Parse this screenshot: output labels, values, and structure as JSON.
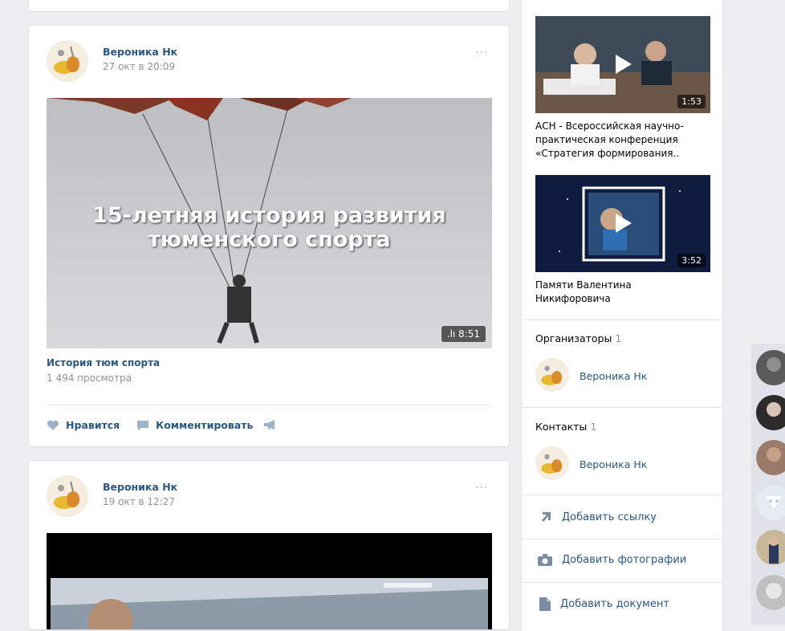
{
  "posts": [
    {
      "author": "Вероника Нк",
      "date": "27 окт в 20:09",
      "more": "···",
      "video": {
        "overlay_line1": "15-летняя история развития",
        "overlay_line2": "тюменского спорта",
        "duration": "8:51",
        "title": "История тюм спорта",
        "views": "1 494 просмотра"
      },
      "actions": {
        "like": "Нравится",
        "comment": "Комментировать"
      }
    },
    {
      "author": "Вероника Нк",
      "date": "19 окт в 12:27",
      "more": "···"
    }
  ],
  "sidebar": {
    "videos": [
      {
        "duration": "1:53",
        "title": "АСН - Всероссийская научно-практическая конференция «Стратегия формирования.."
      },
      {
        "duration": "3:52",
        "title": "Памяти Валентина Никифоровича"
      }
    ],
    "organizers": {
      "label": "Организаторы",
      "count": "1",
      "name": "Вероника Нк"
    },
    "contacts": {
      "label": "Контакты",
      "count": "1",
      "name": "Вероника Нк"
    },
    "links": {
      "add_link": "Добавить ссылку",
      "add_photos": "Добавить фотографии",
      "add_document": "Добавить документ"
    }
  },
  "colors": {
    "link": "#2a5885",
    "muted": "#939393",
    "background": "#edeef0"
  }
}
